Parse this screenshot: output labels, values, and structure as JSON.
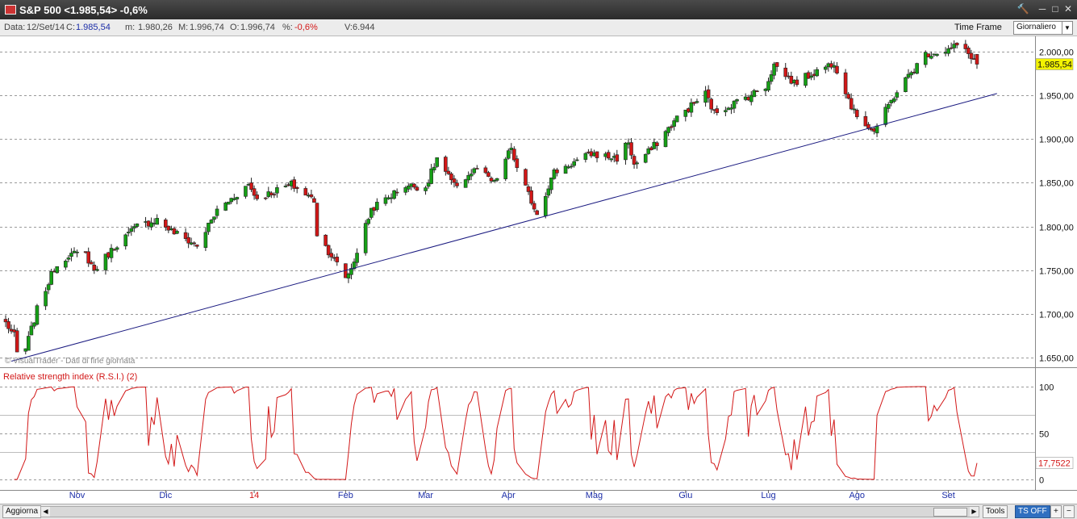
{
  "window": {
    "title": "S&P 500 <1.985,54> -0,6%",
    "controls": [
      "🔨",
      "─",
      "□",
      "✕"
    ]
  },
  "infobar": {
    "data_label": "Data:",
    "data_value": "12/Set/14",
    "close_label": "C:",
    "close_value": "1.985,54",
    "min_label": "m:",
    "min_value": "1.980,26",
    "max_label": "M:",
    "max_value": "1.996,74",
    "open_label": "O:",
    "open_value": "1.996,74",
    "pct_label": "%:",
    "pct_value": "-0,6%",
    "vol_label": "V:",
    "vol_value": "6.944",
    "timeframe_label": "Time Frame",
    "timeframe_value": "Giornaliero"
  },
  "statusbar": {
    "update_button": "Aggiorna",
    "tools_button": "Tools",
    "tsoff_button": "TS OFF",
    "plus": "+",
    "minus": "−"
  },
  "chart_data": [
    {
      "type": "candlestick",
      "title": "",
      "watermark": "© VisualTrader - Dati di fine giornata",
      "ylim": [
        1640,
        2010
      ],
      "y_ticks": [
        1650,
        1700,
        1750,
        1800,
        1850,
        1900,
        1950,
        2000
      ],
      "y_tick_labels": [
        "1.650,00",
        "1.700,00",
        "1.750,00",
        "1.800,00",
        "1.850,00",
        "1.900,00",
        "1.950,00",
        "2.000,00"
      ],
      "grid": "horizontal dashed",
      "last_value_label": "1.985,54",
      "colors": {
        "up": "#15a015",
        "down": "#d21717",
        "trendline": "#1a1a80",
        "last_value_bg": "#f3f300"
      },
      "trendline": {
        "from": {
          "date": "2013-10-09",
          "value": 1646
        },
        "to": {
          "date": "2014-09-19",
          "value": 1952
        }
      },
      "x_month_labels": [
        "Nov",
        "Dic",
        "14",
        "Feb",
        "Mar",
        "Apr",
        "Mag",
        "Giu",
        "Lug",
        "Ago",
        "Set"
      ],
      "x_label_dates": [
        "2013-11-01",
        "2013-12-02",
        "2014-01-02",
        "2014-02-03",
        "2014-03-03",
        "2014-04-01",
        "2014-05-01",
        "2014-06-02",
        "2014-07-01",
        "2014-08-01",
        "2014-09-02"
      ],
      "ohlc_anchor_closes": [
        [
          "2013-10-07",
          1690
        ],
        [
          "2013-10-10",
          1675
        ],
        [
          "2013-10-11",
          1655
        ],
        [
          "2013-10-14",
          1660
        ],
        [
          "2013-10-18",
          1705
        ],
        [
          "2013-10-24",
          1752
        ],
        [
          "2013-10-29",
          1768
        ],
        [
          "2013-11-04",
          1768
        ],
        [
          "2013-11-07",
          1750
        ],
        [
          "2013-11-15",
          1780
        ],
        [
          "2013-11-22",
          1800
        ],
        [
          "2013-11-29",
          1808
        ],
        [
          "2013-12-04",
          1795
        ],
        [
          "2013-12-13",
          1778
        ],
        [
          "2013-12-20",
          1818
        ],
        [
          "2013-12-31",
          1848
        ],
        [
          "2014-01-03",
          1832
        ],
        [
          "2014-01-15",
          1848
        ],
        [
          "2014-01-23",
          1830
        ],
        [
          "2014-01-24",
          1792
        ],
        [
          "2014-02-03",
          1742
        ],
        [
          "2014-02-05",
          1752
        ],
        [
          "2014-02-12",
          1820
        ],
        [
          "2014-02-24",
          1847
        ],
        [
          "2014-03-03",
          1845
        ],
        [
          "2014-03-07",
          1878
        ],
        [
          "2014-03-13",
          1846
        ],
        [
          "2014-03-21",
          1866
        ],
        [
          "2014-03-27",
          1849
        ],
        [
          "2014-04-02",
          1890
        ],
        [
          "2014-04-04",
          1865
        ],
        [
          "2014-04-11",
          1815
        ],
        [
          "2014-04-17",
          1862
        ],
        [
          "2014-04-30",
          1883
        ],
        [
          "2014-05-09",
          1878
        ],
        [
          "2014-05-13",
          1897
        ],
        [
          "2014-05-15",
          1870
        ],
        [
          "2014-05-21",
          1888
        ],
        [
          "2014-05-30",
          1924
        ],
        [
          "2014-06-09",
          1952
        ],
        [
          "2014-06-12",
          1930
        ],
        [
          "2014-06-24",
          1949
        ],
        [
          "2014-06-30",
          1960
        ],
        [
          "2014-07-03",
          1985
        ],
        [
          "2014-07-10",
          1964
        ],
        [
          "2014-07-24",
          1988
        ],
        [
          "2014-07-31",
          1930
        ],
        [
          "2014-08-07",
          1909
        ],
        [
          "2014-08-15",
          1955
        ],
        [
          "2014-08-25",
          1997
        ],
        [
          "2014-09-02",
          2002
        ],
        [
          "2014-09-05",
          2007
        ],
        [
          "2014-09-10",
          1995
        ],
        [
          "2014-09-12",
          1985.54
        ]
      ]
    },
    {
      "type": "line",
      "title": "Relative strength index (R.S.I.) (2)",
      "ylim": [
        0,
        100
      ],
      "y_ticks": [
        0,
        50,
        100
      ],
      "y_tick_labels": [
        "0",
        "50",
        "100"
      ],
      "reference_levels": [
        30,
        70
      ],
      "last_value_label": "17,7522",
      "period": 2,
      "colors": {
        "line": "#d21717",
        "label": "#d21717"
      }
    }
  ]
}
